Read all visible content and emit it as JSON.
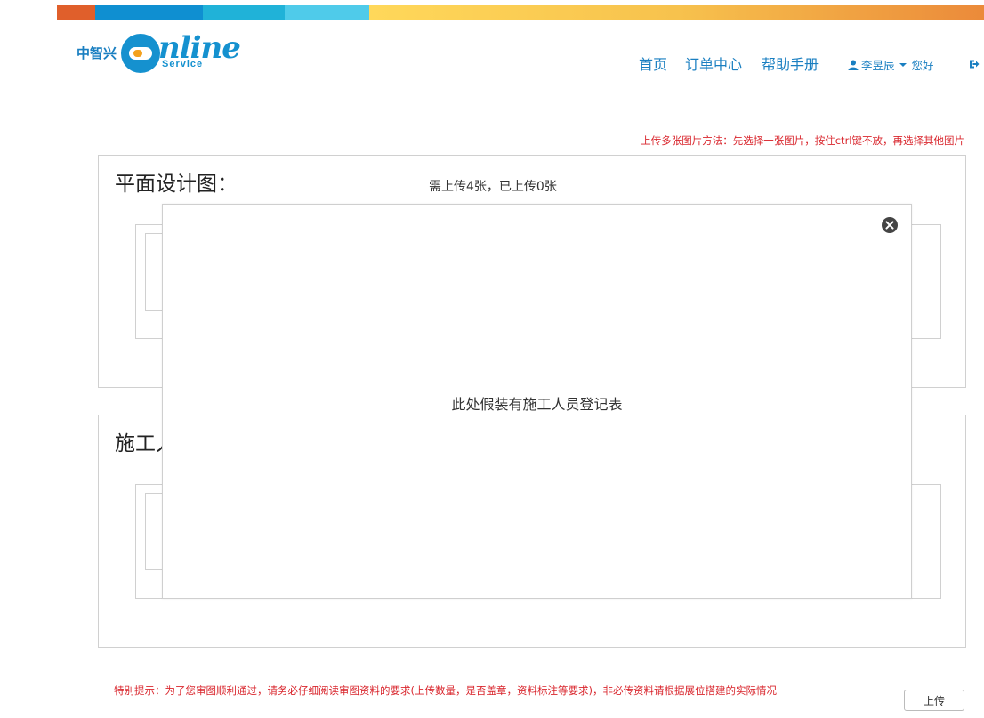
{
  "topbar": {
    "colors": [
      "#e05f2b",
      "#0f8fd1",
      "#20b2d8",
      "#4fcbea",
      "#ffd85a",
      "#eb8a3a"
    ]
  },
  "logo": {
    "cn": "中智兴",
    "online": "nline",
    "service": "Service"
  },
  "nav": {
    "items": [
      "首页",
      "订单中心",
      "帮助手册"
    ]
  },
  "user": {
    "icon": "user-icon",
    "name": "李昱辰",
    "greeting": "您好",
    "logout_icon": "sign-out-icon"
  },
  "tips": {
    "top": "上传多张图片方法：先选择一张图片，按住ctrl键不放，再选择其他图片",
    "bottom": "特别提示：为了您审图顺利通过，请务必仔细阅读审图资料的要求(上传数量，是否盖章，资料标注等要求)，非必传资料请根据展位搭建的实际情况"
  },
  "panels": [
    {
      "title": "平面设计图：",
      "count": "需上传4张，已上传0张"
    },
    {
      "title": "施工人"
    }
  ],
  "modal": {
    "text": "此处假装有施工人员登记表",
    "close_icon": "close-icon"
  },
  "actions": {
    "upload_label": "上传"
  }
}
